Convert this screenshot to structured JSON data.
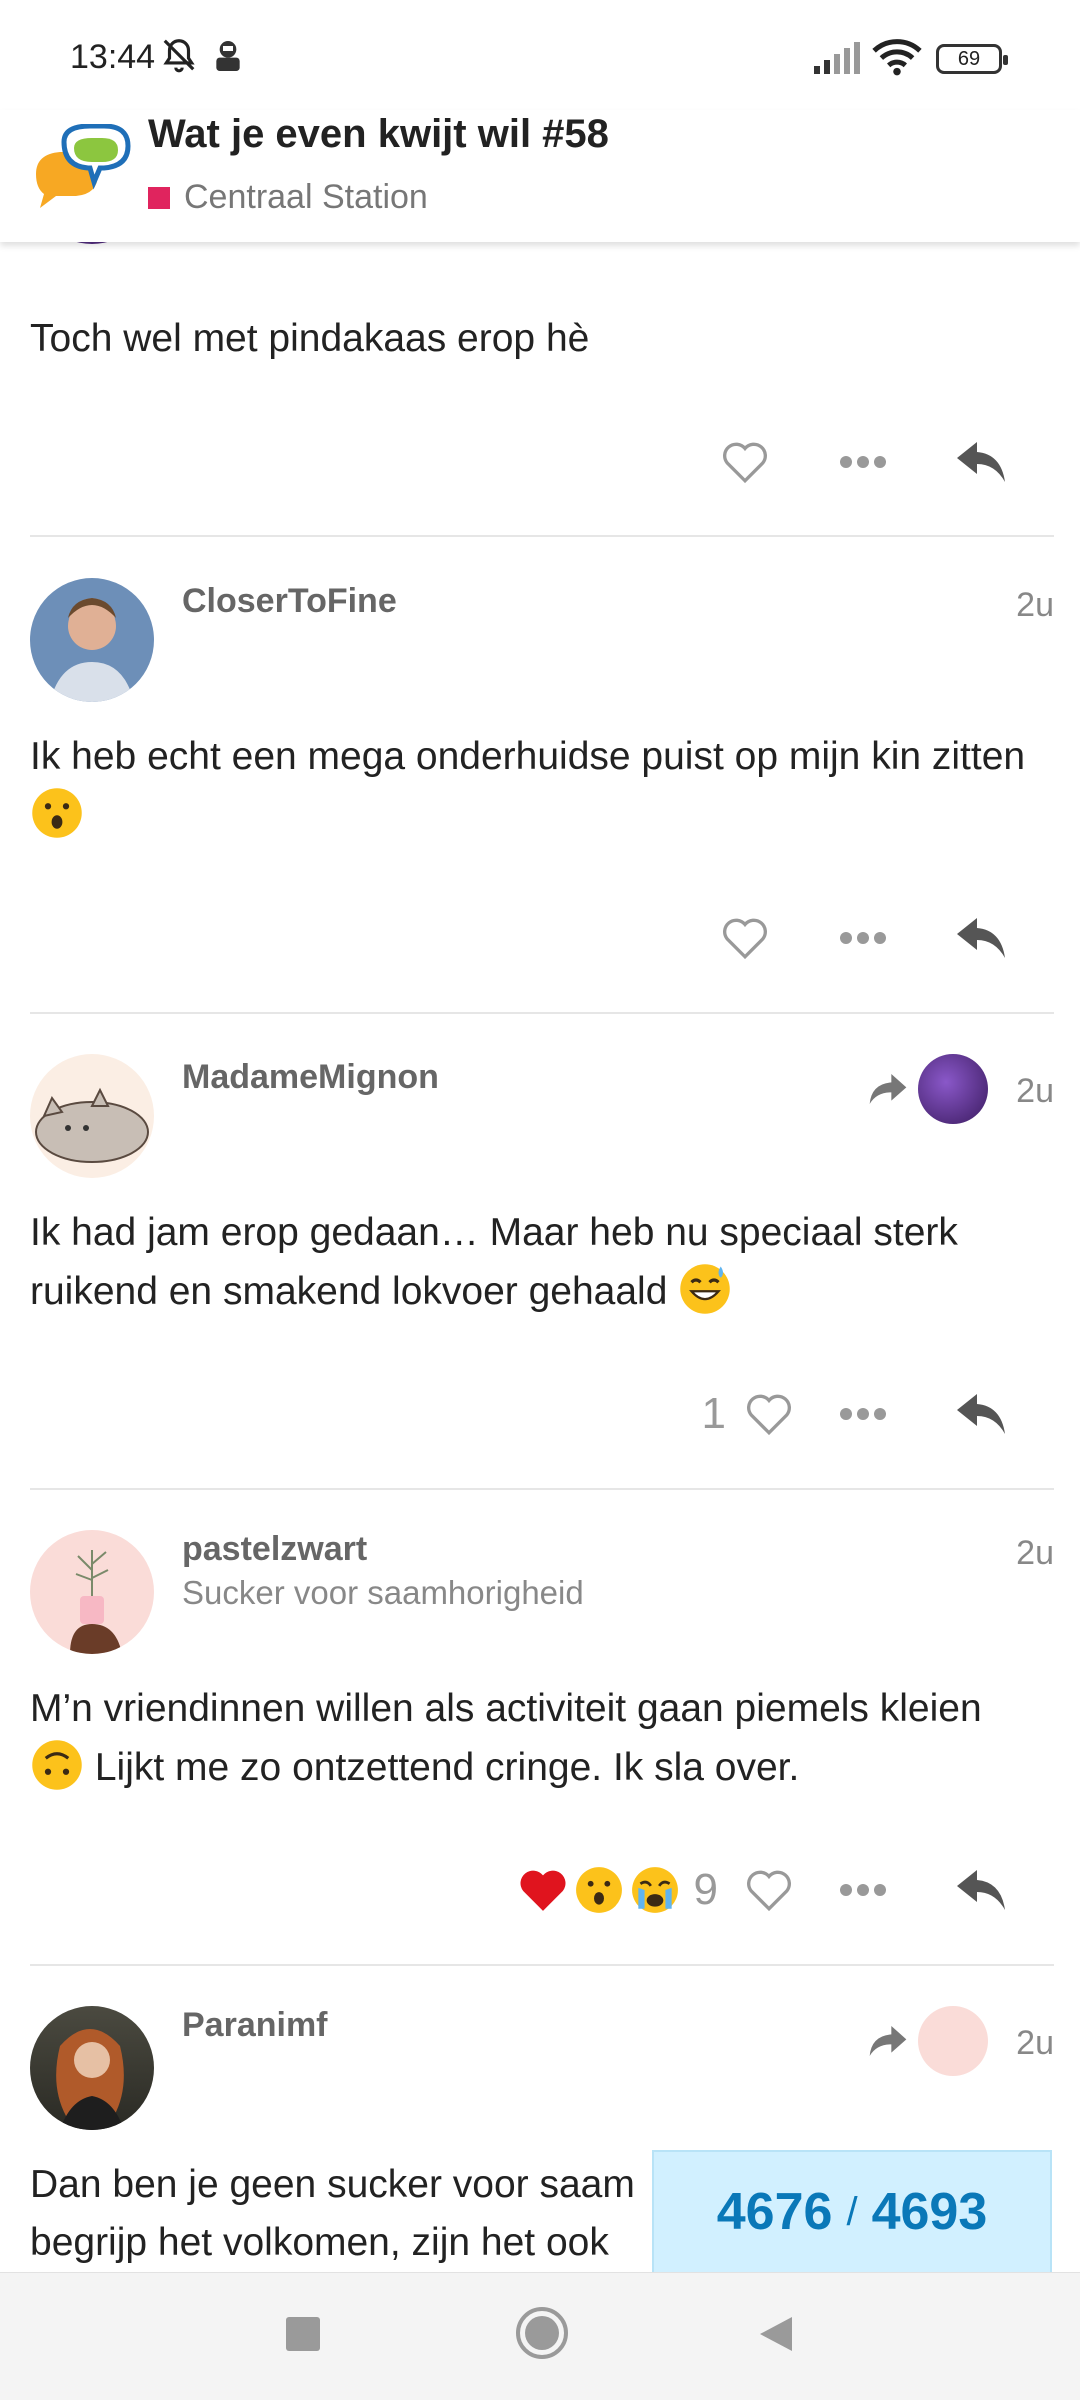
{
  "status_bar": {
    "time": "13:44",
    "battery": "69"
  },
  "header": {
    "title": "Wat je even kwijt wil #58",
    "category": "Centraal Station",
    "category_color": "#e0245e"
  },
  "posts": [
    {
      "body": "Toch wel met pindakaas erop hè"
    },
    {
      "username": "CloserToFine",
      "time": "2u",
      "body": "Ik heb echt een mega onderhuidse puist op mijn kin zitten"
    },
    {
      "username": "MadameMignon",
      "time": "2u",
      "body": "Ik had jam erop gedaan… Maar heb nu speciaal sterk ruikend en smakend lokvoer gehaald",
      "like_count": "1"
    },
    {
      "username": "pastelzwart",
      "user_title": "Sucker voor saamhorigheid",
      "time": "2u",
      "body_line1": "M’n vriendinnen willen als activiteit gaan piemels kleien",
      "body_line2": "Lijkt me zo ontzettend cringe. Ik sla over.",
      "reaction_count": "9"
    },
    {
      "username": "Paranimf",
      "time": "2u",
      "body_line1": "Dan ben je geen sucker voor saam",
      "body_line2": "begrijp het volkomen, zijn het ook"
    }
  ],
  "progress": {
    "current": "4676",
    "total": "4693"
  },
  "colors": {
    "accent": "#0a78b8",
    "progress_bg": "#d1f0ff"
  }
}
